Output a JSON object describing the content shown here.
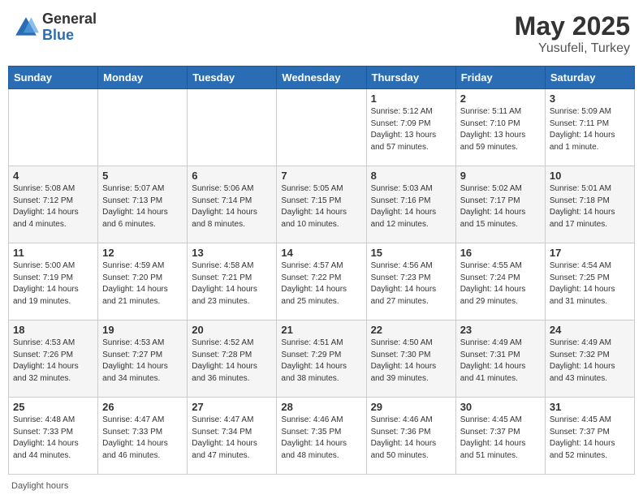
{
  "header": {
    "logo_general": "General",
    "logo_blue": "Blue",
    "month_year": "May 2025",
    "location": "Yusufeli, Turkey"
  },
  "footer": {
    "daylight_label": "Daylight hours"
  },
  "weekdays": [
    "Sunday",
    "Monday",
    "Tuesday",
    "Wednesday",
    "Thursday",
    "Friday",
    "Saturday"
  ],
  "weeks": [
    [
      {
        "day": "",
        "sunrise": "",
        "sunset": "",
        "daylight": ""
      },
      {
        "day": "",
        "sunrise": "",
        "sunset": "",
        "daylight": ""
      },
      {
        "day": "",
        "sunrise": "",
        "sunset": "",
        "daylight": ""
      },
      {
        "day": "",
        "sunrise": "",
        "sunset": "",
        "daylight": ""
      },
      {
        "day": "1",
        "sunrise": "Sunrise: 5:12 AM",
        "sunset": "Sunset: 7:09 PM",
        "daylight": "Daylight: 13 hours and 57 minutes."
      },
      {
        "day": "2",
        "sunrise": "Sunrise: 5:11 AM",
        "sunset": "Sunset: 7:10 PM",
        "daylight": "Daylight: 13 hours and 59 minutes."
      },
      {
        "day": "3",
        "sunrise": "Sunrise: 5:09 AM",
        "sunset": "Sunset: 7:11 PM",
        "daylight": "Daylight: 14 hours and 1 minute."
      }
    ],
    [
      {
        "day": "4",
        "sunrise": "Sunrise: 5:08 AM",
        "sunset": "Sunset: 7:12 PM",
        "daylight": "Daylight: 14 hours and 4 minutes."
      },
      {
        "day": "5",
        "sunrise": "Sunrise: 5:07 AM",
        "sunset": "Sunset: 7:13 PM",
        "daylight": "Daylight: 14 hours and 6 minutes."
      },
      {
        "day": "6",
        "sunrise": "Sunrise: 5:06 AM",
        "sunset": "Sunset: 7:14 PM",
        "daylight": "Daylight: 14 hours and 8 minutes."
      },
      {
        "day": "7",
        "sunrise": "Sunrise: 5:05 AM",
        "sunset": "Sunset: 7:15 PM",
        "daylight": "Daylight: 14 hours and 10 minutes."
      },
      {
        "day": "8",
        "sunrise": "Sunrise: 5:03 AM",
        "sunset": "Sunset: 7:16 PM",
        "daylight": "Daylight: 14 hours and 12 minutes."
      },
      {
        "day": "9",
        "sunrise": "Sunrise: 5:02 AM",
        "sunset": "Sunset: 7:17 PM",
        "daylight": "Daylight: 14 hours and 15 minutes."
      },
      {
        "day": "10",
        "sunrise": "Sunrise: 5:01 AM",
        "sunset": "Sunset: 7:18 PM",
        "daylight": "Daylight: 14 hours and 17 minutes."
      }
    ],
    [
      {
        "day": "11",
        "sunrise": "Sunrise: 5:00 AM",
        "sunset": "Sunset: 7:19 PM",
        "daylight": "Daylight: 14 hours and 19 minutes."
      },
      {
        "day": "12",
        "sunrise": "Sunrise: 4:59 AM",
        "sunset": "Sunset: 7:20 PM",
        "daylight": "Daylight: 14 hours and 21 minutes."
      },
      {
        "day": "13",
        "sunrise": "Sunrise: 4:58 AM",
        "sunset": "Sunset: 7:21 PM",
        "daylight": "Daylight: 14 hours and 23 minutes."
      },
      {
        "day": "14",
        "sunrise": "Sunrise: 4:57 AM",
        "sunset": "Sunset: 7:22 PM",
        "daylight": "Daylight: 14 hours and 25 minutes."
      },
      {
        "day": "15",
        "sunrise": "Sunrise: 4:56 AM",
        "sunset": "Sunset: 7:23 PM",
        "daylight": "Daylight: 14 hours and 27 minutes."
      },
      {
        "day": "16",
        "sunrise": "Sunrise: 4:55 AM",
        "sunset": "Sunset: 7:24 PM",
        "daylight": "Daylight: 14 hours and 29 minutes."
      },
      {
        "day": "17",
        "sunrise": "Sunrise: 4:54 AM",
        "sunset": "Sunset: 7:25 PM",
        "daylight": "Daylight: 14 hours and 31 minutes."
      }
    ],
    [
      {
        "day": "18",
        "sunrise": "Sunrise: 4:53 AM",
        "sunset": "Sunset: 7:26 PM",
        "daylight": "Daylight: 14 hours and 32 minutes."
      },
      {
        "day": "19",
        "sunrise": "Sunrise: 4:53 AM",
        "sunset": "Sunset: 7:27 PM",
        "daylight": "Daylight: 14 hours and 34 minutes."
      },
      {
        "day": "20",
        "sunrise": "Sunrise: 4:52 AM",
        "sunset": "Sunset: 7:28 PM",
        "daylight": "Daylight: 14 hours and 36 minutes."
      },
      {
        "day": "21",
        "sunrise": "Sunrise: 4:51 AM",
        "sunset": "Sunset: 7:29 PM",
        "daylight": "Daylight: 14 hours and 38 minutes."
      },
      {
        "day": "22",
        "sunrise": "Sunrise: 4:50 AM",
        "sunset": "Sunset: 7:30 PM",
        "daylight": "Daylight: 14 hours and 39 minutes."
      },
      {
        "day": "23",
        "sunrise": "Sunrise: 4:49 AM",
        "sunset": "Sunset: 7:31 PM",
        "daylight": "Daylight: 14 hours and 41 minutes."
      },
      {
        "day": "24",
        "sunrise": "Sunrise: 4:49 AM",
        "sunset": "Sunset: 7:32 PM",
        "daylight": "Daylight: 14 hours and 43 minutes."
      }
    ],
    [
      {
        "day": "25",
        "sunrise": "Sunrise: 4:48 AM",
        "sunset": "Sunset: 7:33 PM",
        "daylight": "Daylight: 14 hours and 44 minutes."
      },
      {
        "day": "26",
        "sunrise": "Sunrise: 4:47 AM",
        "sunset": "Sunset: 7:33 PM",
        "daylight": "Daylight: 14 hours and 46 minutes."
      },
      {
        "day": "27",
        "sunrise": "Sunrise: 4:47 AM",
        "sunset": "Sunset: 7:34 PM",
        "daylight": "Daylight: 14 hours and 47 minutes."
      },
      {
        "day": "28",
        "sunrise": "Sunrise: 4:46 AM",
        "sunset": "Sunset: 7:35 PM",
        "daylight": "Daylight: 14 hours and 48 minutes."
      },
      {
        "day": "29",
        "sunrise": "Sunrise: 4:46 AM",
        "sunset": "Sunset: 7:36 PM",
        "daylight": "Daylight: 14 hours and 50 minutes."
      },
      {
        "day": "30",
        "sunrise": "Sunrise: 4:45 AM",
        "sunset": "Sunset: 7:37 PM",
        "daylight": "Daylight: 14 hours and 51 minutes."
      },
      {
        "day": "31",
        "sunrise": "Sunrise: 4:45 AM",
        "sunset": "Sunset: 7:37 PM",
        "daylight": "Daylight: 14 hours and 52 minutes."
      }
    ]
  ]
}
